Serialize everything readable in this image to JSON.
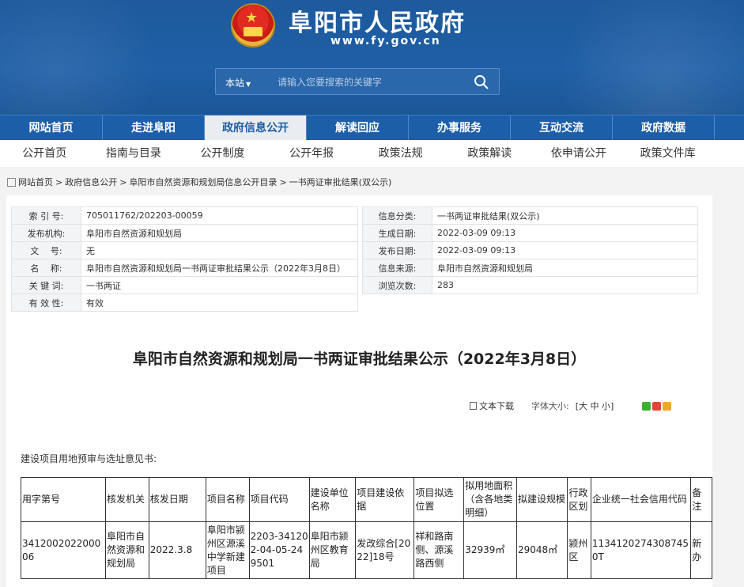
{
  "site": {
    "title": "阜阳市人民政府",
    "url": "www.fy.gov.cn"
  },
  "search": {
    "scope": "本站",
    "placeholder": "请输入您要搜索的关键字"
  },
  "mainnav": [
    "网站首页",
    "走进阜阳",
    "政府信息公开",
    "解读回应",
    "办事服务",
    "互动交流",
    "政府数据"
  ],
  "subnav": [
    "公开首页",
    "指南与目录",
    "公开制度",
    "公开年报",
    "政策法规",
    "政策解读",
    "依申请公开",
    "政策文件库"
  ],
  "breadcrumb": [
    "网站首页",
    "政府信息公开",
    "阜阳市自然资源和规划局信息公开目录",
    "一书两证审批结果(双公示)"
  ],
  "info_left": [
    {
      "k": "索 引 号:",
      "v": "705011762/202203-00059"
    },
    {
      "k": "发布机构:",
      "v": "阜阳市自然资源和规划局"
    },
    {
      "k": "文　 号:",
      "v": "无"
    },
    {
      "k": "名　 称:",
      "v": "阜阳市自然资源和规划局一书两证审批结果公示（2022年3月8日）"
    },
    {
      "k": "关 键 词:",
      "v": "一书两证"
    },
    {
      "k": "有 效 性:",
      "v": "有效"
    }
  ],
  "info_right": [
    {
      "k": "信息分类:",
      "v": "一书两证审批结果(双公示)"
    },
    {
      "k": "生成日期:",
      "v": "2022-03-09 09:13"
    },
    {
      "k": "发布日期:",
      "v": "2022-03-09 09:13"
    },
    {
      "k": "信息来源:",
      "v": "阜阳市自然资源和规划局"
    },
    {
      "k": "浏览次数:",
      "v": "283"
    }
  ],
  "doc": {
    "title": "阜阳市自然资源和规划局一书两证审批结果公示（2022年3月8日）",
    "download": "文本下载",
    "font_size_label": "字体大小:",
    "font_sizes": "[大 中 小]",
    "section_label": "建设项目用地预审与选址意见书:"
  },
  "table": {
    "headers": [
      "用字第号",
      "核发机关",
      "核发日期",
      "项目名称",
      "项目代码",
      "建设单位名称",
      "项目建设依据",
      "项目拟选位置",
      "拟用地面积（含各地类明细）",
      "拟建设规模",
      "行政区划",
      "企业统一社会信用代码",
      "备注"
    ],
    "rows": [
      [
        "341200202200006",
        "阜阳市自然资源和规划局",
        "2022.3.8",
        "阜阳市颍州区源溪中学新建项目",
        "2203-341202-04-05-249501",
        "阜阳市颍州区教育局",
        "发改综合[2022]18号",
        "祥和路南侧、源溪路西侧",
        "32939㎡",
        "29048㎡",
        "颍州区",
        "11341202743087450T",
        "新办"
      ]
    ]
  }
}
